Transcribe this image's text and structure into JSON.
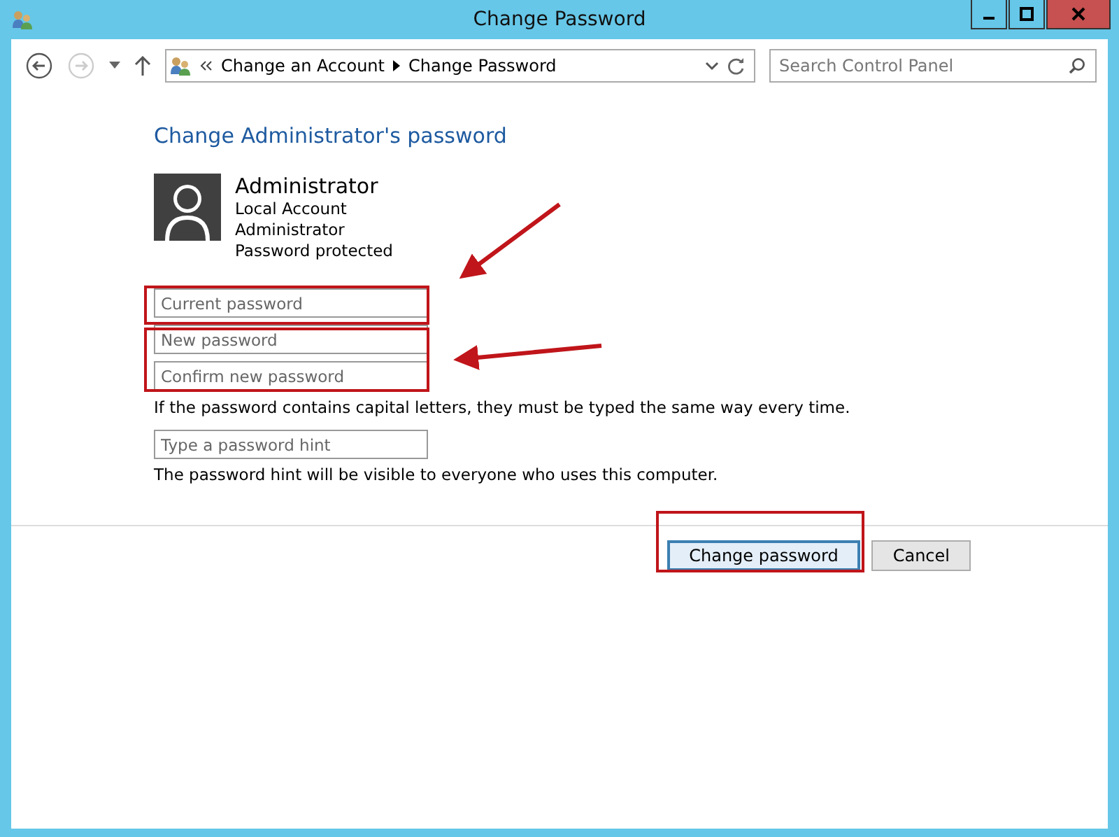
{
  "window": {
    "title": "Change Password"
  },
  "address": {
    "crumbs": [
      "Change an Account",
      "Change Password"
    ]
  },
  "search": {
    "placeholder": "Search Control Panel"
  },
  "heading": "Change Administrator's password",
  "account": {
    "name": "Administrator",
    "lines": [
      "Local Account",
      "Administrator",
      "Password protected"
    ]
  },
  "password_fields": [
    {
      "placeholder": "Current password"
    },
    {
      "placeholder": "New password"
    },
    {
      "placeholder": "Confirm new password"
    }
  ],
  "capitals_note": "If the password contains capital letters, they must be typed the same way every time.",
  "hint_field": {
    "placeholder": "Type a password hint"
  },
  "hint_note": "The password hint will be visible to everyone who uses this computer.",
  "buttons": [
    {
      "label": "Change password",
      "default": true
    },
    {
      "label": "Cancel",
      "default": false
    }
  ]
}
